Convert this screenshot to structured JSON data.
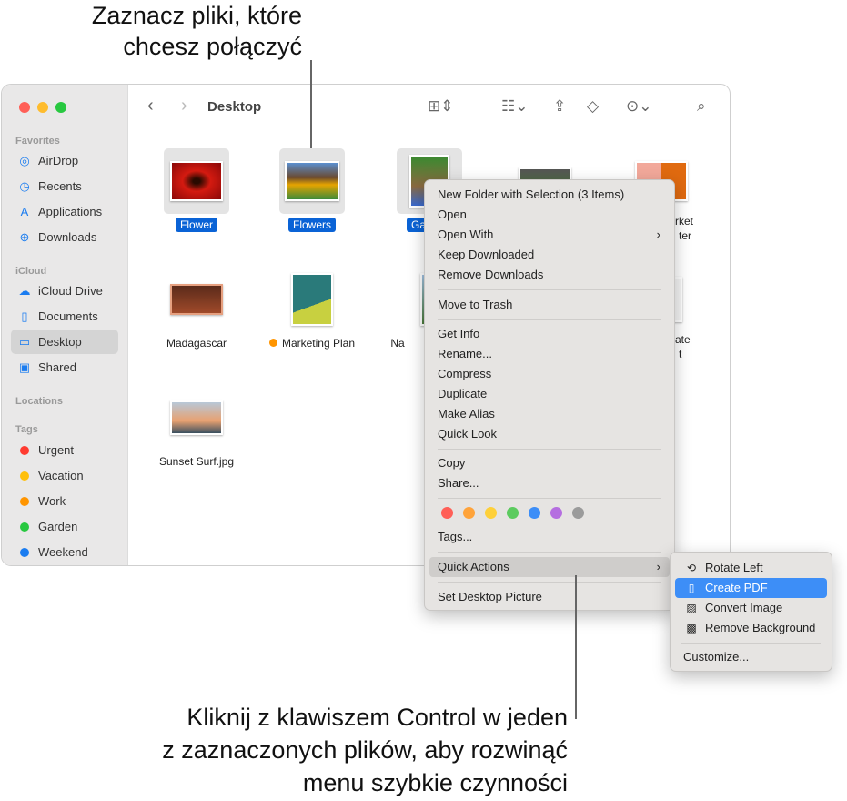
{
  "annotations": {
    "top": [
      "Zaznacz pliki, które",
      "chcesz połączyć"
    ],
    "bottom": [
      "Kliknij z klawiszem Control w jeden",
      "z zaznaczonych plików, aby rozwinąć",
      "menu szybkie czynności"
    ]
  },
  "window": {
    "title": "Desktop",
    "traffic_lights": [
      "#ff5f57",
      "#febc2e",
      "#28c840"
    ]
  },
  "sidebar": {
    "favorites_label": "Favorites",
    "favorites": [
      {
        "label": "AirDrop",
        "icon": "airdrop-icon"
      },
      {
        "label": "Recents",
        "icon": "clock-icon"
      },
      {
        "label": "Applications",
        "icon": "applications-icon"
      },
      {
        "label": "Downloads",
        "icon": "download-icon"
      }
    ],
    "icloud_label": "iCloud",
    "icloud": [
      {
        "label": "iCloud Drive",
        "icon": "cloud-icon"
      },
      {
        "label": "Documents",
        "icon": "document-icon"
      },
      {
        "label": "Desktop",
        "icon": "desktop-icon",
        "selected": true
      },
      {
        "label": "Shared",
        "icon": "shared-folder-icon"
      }
    ],
    "locations_label": "Locations",
    "tags_label": "Tags",
    "tags": [
      {
        "label": "Urgent",
        "color": "#ff3b30"
      },
      {
        "label": "Vacation",
        "color": "#ffc00a"
      },
      {
        "label": "Work",
        "color": "#ff9500"
      },
      {
        "label": "Garden",
        "color": "#28c840"
      },
      {
        "label": "Weekend",
        "color": "#1a7cf0"
      }
    ]
  },
  "files": [
    {
      "name": "Flower",
      "selected": true
    },
    {
      "name": "Flowers",
      "selected": true
    },
    {
      "name": "Garden",
      "selected": true
    },
    {
      "name": ""
    },
    {
      "name": "rket",
      "name2": "ter"
    },
    {
      "name": "Madagascar"
    },
    {
      "name": "Marketing Plan",
      "tag_color": "#ff9500"
    },
    {
      "name": "Na"
    },
    {
      "name": ""
    },
    {
      "name": "ate",
      "name2": "t"
    },
    {
      "name": "Sunset Surf.jpg"
    }
  ],
  "context_menu": {
    "items": [
      "New Folder with Selection (3 Items)",
      "Open",
      "Open With",
      "Keep Downloaded",
      "Remove Downloads",
      "Move to Trash",
      "Get Info",
      "Rename...",
      "Compress",
      "Duplicate",
      "Make Alias",
      "Quick Look",
      "Copy",
      "Share...",
      "Tags...",
      "Quick Actions",
      "Set Desktop Picture"
    ],
    "tag_colors": [
      "#ff5f57",
      "#ffa33a",
      "#fed03a",
      "#5ccb5f",
      "#3d8ef7",
      "#b56ee0",
      "#9b9b9b"
    ]
  },
  "submenu": {
    "items": [
      {
        "label": "Rotate Left",
        "icon": "rotate-left-icon"
      },
      {
        "label": "Create PDF",
        "icon": "pdf-document-icon",
        "highlighted": true
      },
      {
        "label": "Convert Image",
        "icon": "convert-image-icon"
      },
      {
        "label": "Remove Background",
        "icon": "remove-background-icon"
      }
    ],
    "customize": "Customize..."
  }
}
